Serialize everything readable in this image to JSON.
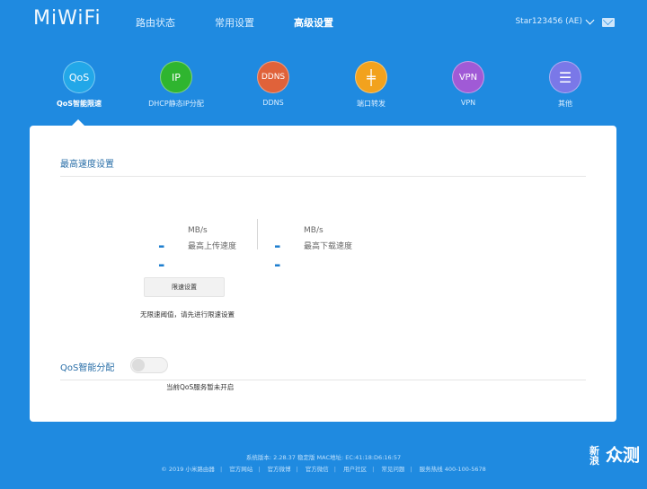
{
  "header": {
    "logo": "MiWiFi",
    "nav": [
      "路由状态",
      "常用设置",
      "高级设置"
    ],
    "active_nav": 2,
    "user": "Star123456 (AE)"
  },
  "features": [
    {
      "icon_text": "QoS",
      "label": "QoS智能限速",
      "color": "#22a7e8",
      "icon": "qos-icon"
    },
    {
      "icon_text": "IP",
      "label": "DHCP静态IP分配",
      "color": "#2fb52f",
      "icon": "ip-icon"
    },
    {
      "icon_text": "DDNS",
      "label": "DDNS",
      "color": "#e0623a",
      "icon": "ddns-icon"
    },
    {
      "icon_text": "╪",
      "label": "端口转发",
      "color": "#f2a21d",
      "icon": "port-forward-icon"
    },
    {
      "icon_text": "VPN",
      "label": "VPN",
      "color": "#a05ad6",
      "icon": "vpn-icon"
    },
    {
      "icon_text": "☰",
      "label": "其他",
      "color": "#7a78e8",
      "icon": "menu-icon"
    }
  ],
  "panel": {
    "section_title": "最高速度设置",
    "upload": {
      "value": "- -",
      "unit": "MB/s",
      "label": "最高上传速度"
    },
    "download": {
      "value": "- -",
      "unit": "MB/s",
      "label": "最高下载速度"
    },
    "limit_button": "限速设置",
    "hint": "无限速阈值，请先进行限速设置",
    "qos_label": "QoS智能分配",
    "qos_enabled": false,
    "qos_status": "当前QoS服务暂未开启"
  },
  "footer": {
    "version": "系统版本: 2.28.37 稳定版  MAC地址: EC:41:18:D6:16:57",
    "links": [
      "© 2019 小米路由器",
      "官方网站",
      "官方微博",
      "官方微信",
      "用户社区",
      "常见问题",
      "服务热线 400-100-5678"
    ]
  },
  "watermark": {
    "small": "新浪",
    "big": "众测"
  }
}
